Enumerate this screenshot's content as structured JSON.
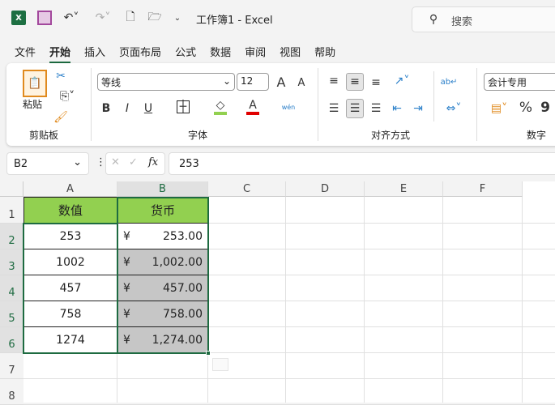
{
  "titlebar": {
    "title": "工作簿1  -  Excel",
    "search_placeholder": "搜索"
  },
  "tabs": [
    "文件",
    "开始",
    "插入",
    "页面布局",
    "公式",
    "数据",
    "审阅",
    "视图",
    "帮助"
  ],
  "ribbon": {
    "clipboard": {
      "paste": "粘贴",
      "group": "剪贴板"
    },
    "font": {
      "name": "等线",
      "size": "12",
      "bold": "B",
      "italic": "I",
      "underline": "U",
      "font_color": "A",
      "grow": "A",
      "shrink": "A",
      "phonetic": "wén",
      "group": "字体",
      "fill_color": "#92d050",
      "text_color": "#e00000"
    },
    "alignment": {
      "group": "对齐方式"
    },
    "number": {
      "format": "会计专用",
      "percent": "%",
      "comma": "9",
      "group": "数字"
    }
  },
  "formula_bar": {
    "name_box": "B2",
    "fx": "fx",
    "value": "253"
  },
  "columns": [
    "A",
    "B",
    "C",
    "D",
    "E",
    "F"
  ],
  "rows": [
    "1",
    "2",
    "3",
    "4",
    "5",
    "6",
    "7",
    "8"
  ],
  "table": {
    "headers": [
      "数值",
      "货币"
    ],
    "values": [
      "253",
      "1002",
      "457",
      "758",
      "1274"
    ],
    "currency_symbol": "¥",
    "currency": [
      "253.00",
      "1,002.00",
      "457.00",
      "758.00",
      "1,274.00"
    ],
    "header_color": "#92d050"
  }
}
